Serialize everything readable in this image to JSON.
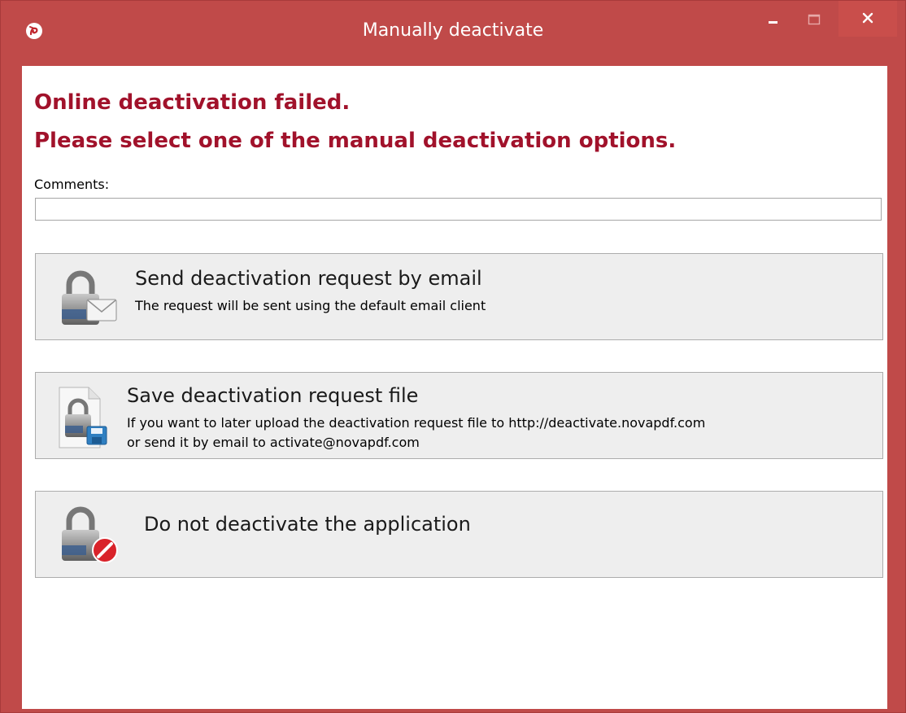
{
  "window": {
    "title": "Manually deactivate",
    "accent_color": "#c04a49",
    "heading_color": "#a1122b",
    "icons": {
      "app": "novapdf-app-icon",
      "minimize": "minimize-icon",
      "maximize": "maximize-icon",
      "close": "close-icon"
    }
  },
  "message": {
    "line1": "Online deactivation failed.",
    "line2": "Please select one of the manual deactivation options."
  },
  "comments": {
    "label": "Comments:",
    "value": "",
    "placeholder": ""
  },
  "options": [
    {
      "title": "Send deactivation request by email",
      "description": "The request will be sent using the default email client",
      "icon": "lock-email-icon"
    },
    {
      "title": "Save deactivation request file",
      "description_line1": "If you want to later upload the deactivation request file to http://deactivate.novapdf.com",
      "description_line2": "or send it by email to activate@novapdf.com",
      "icon": "lock-file-save-icon"
    },
    {
      "title": "Do not deactivate the application",
      "icon": "lock-cancel-icon"
    }
  ]
}
